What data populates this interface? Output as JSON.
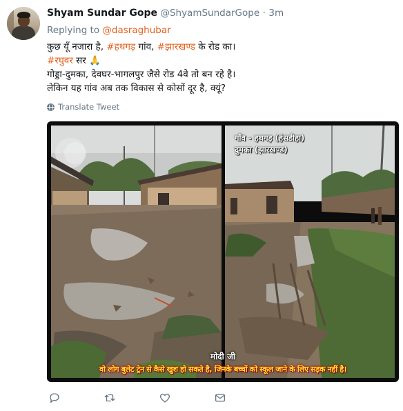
{
  "tweet": {
    "author": {
      "display_name": "Shyam Sundar Gope",
      "handle": "@ShyamSundarGope",
      "separator": "·",
      "time": "3m"
    },
    "reply": {
      "prefix": "Replying to",
      "mention": "@dasraghubar"
    },
    "text": {
      "line1": {
        "a": "कुछ यूँ नजारा है, ",
        "tag1": "#हथगड़",
        "b": " गांव, ",
        "tag2": "#झारखण्ड",
        "c": " के रोड का।"
      },
      "line2": {
        "tag": "#रघुवर",
        "a": " सर ",
        "emoji": "🙏"
      },
      "line3": "गोड्डा-दुमका, देवघर-भागलपुर जैसे रोड 4वे तो बन रहे है।",
      "line4": "लेकिन यह गांव अब तक विकास से कोसों दूर है, क्यूं?"
    },
    "translate_label": "Translate Tweet",
    "media": {
      "caption_right_line1": "गाँव - हथगड़ (हंसडीहा)",
      "caption_right_line2": "दुमका (झारखण्ड)",
      "overlay_title": "मोदी जी",
      "overlay_line": "वो लोग बुलेट ट्रेन से कैसे खुश हो सकते है, जिनके बच्चों को स्कूल जाने के लिए सड़क नहीं है।"
    },
    "actions": [
      "reply-icon",
      "retweet-icon",
      "like-icon",
      "dm-icon"
    ],
    "colors": {
      "link": "#e0621f",
      "muted": "#657786",
      "overlay_text": "#ffe233",
      "overlay_stroke": "#b40000"
    }
  }
}
